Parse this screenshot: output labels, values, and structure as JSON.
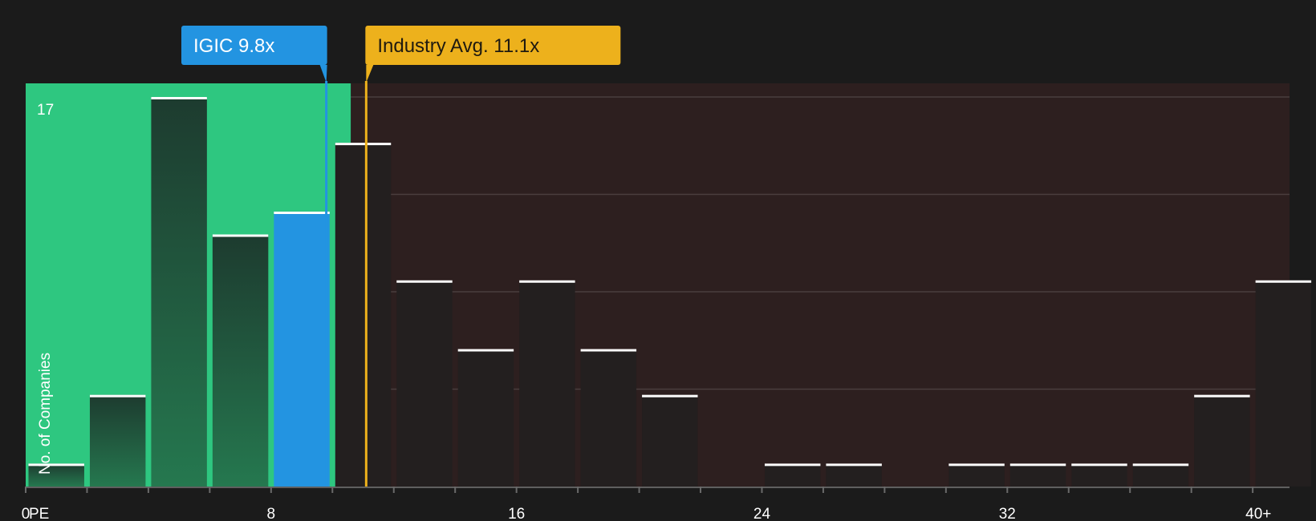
{
  "colors": {
    "background": "#1b1b1b",
    "fair_region": "#2ec780",
    "expensive_region": "#2d1f1f",
    "highlight_bar": "#2394e1",
    "company_marker": "#2394e1",
    "industry_marker": "#edb11c"
  },
  "chart_data": {
    "type": "bar",
    "xlabel": "PE",
    "ylabel": "No. of Companies",
    "ymax_label": "17",
    "ylim": [
      0,
      17
    ],
    "xlim": [
      0,
      41.2
    ],
    "bin_width": 2,
    "x_ticks": [
      {
        "value": 0,
        "label": "0"
      },
      {
        "value": 8,
        "label": "8"
      },
      {
        "value": 16,
        "label": "16"
      },
      {
        "value": 24,
        "label": "24"
      },
      {
        "value": 32,
        "label": "32"
      },
      {
        "value": 40,
        "label": "40+"
      }
    ],
    "bins": [
      {
        "x": 0,
        "count": 1
      },
      {
        "x": 2,
        "count": 4
      },
      {
        "x": 4,
        "count": 17
      },
      {
        "x": 6,
        "count": 11
      },
      {
        "x": 8,
        "count": 12
      },
      {
        "x": 10,
        "count": 15
      },
      {
        "x": 12,
        "count": 9
      },
      {
        "x": 14,
        "count": 6
      },
      {
        "x": 16,
        "count": 9
      },
      {
        "x": 18,
        "count": 6
      },
      {
        "x": 20,
        "count": 4
      },
      {
        "x": 22,
        "count": 0
      },
      {
        "x": 24,
        "count": 1
      },
      {
        "x": 26,
        "count": 1
      },
      {
        "x": 28,
        "count": 0
      },
      {
        "x": 30,
        "count": 1
      },
      {
        "x": 32,
        "count": 1
      },
      {
        "x": 34,
        "count": 1
      },
      {
        "x": 36,
        "count": 1
      },
      {
        "x": 38,
        "count": 4
      },
      {
        "x": 40,
        "count": 9
      }
    ],
    "highlight_bin_x": 8,
    "fair_value_upper": 10.6,
    "markers": {
      "company": {
        "label": "IGIC 9.8x",
        "value": 9.8
      },
      "industry": {
        "label": "Industry Avg. 11.1x",
        "value": 11.1
      }
    },
    "grid": true
  }
}
